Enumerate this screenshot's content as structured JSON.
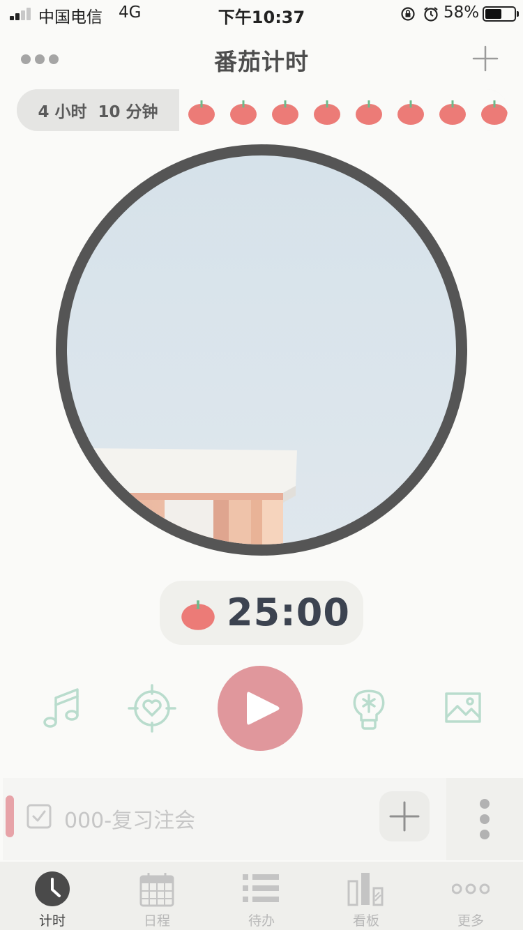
{
  "status_bar": {
    "carrier": "中国电信",
    "network": "4G",
    "time": "下午10:37",
    "battery_percent": "58%",
    "battery_level": 0.58
  },
  "nav": {
    "title": "番茄计时",
    "left_icon": "more-dots-icon",
    "right_icon": "plus-icon"
  },
  "summary": {
    "total_time": "4 小时  10 分钟",
    "tomato_count_visible": 8
  },
  "timer": {
    "remaining": "25:00",
    "background": "sky-building-photo"
  },
  "controls": [
    {
      "name": "music-icon"
    },
    {
      "name": "focus-target-icon"
    },
    {
      "name": "play-icon"
    },
    {
      "name": "lightbulb-icon"
    },
    {
      "name": "image-icon"
    }
  ],
  "task": {
    "label": "000-复习注会"
  },
  "tabs": [
    {
      "label": "计时",
      "icon": "clock-icon",
      "active": true
    },
    {
      "label": "日程",
      "icon": "calendar-icon",
      "active": false
    },
    {
      "label": "待办",
      "icon": "list-icon",
      "active": false
    },
    {
      "label": "看板",
      "icon": "bar-chart-icon",
      "active": false
    },
    {
      "label": "更多",
      "icon": "more-dots-icon",
      "active": false
    }
  ],
  "colors": {
    "tomato": "#ec7b77",
    "tomato_leaf": "#6dba8a",
    "accent_mint": "#b9dccd",
    "play": "#e0979c",
    "ring": "#555555"
  }
}
